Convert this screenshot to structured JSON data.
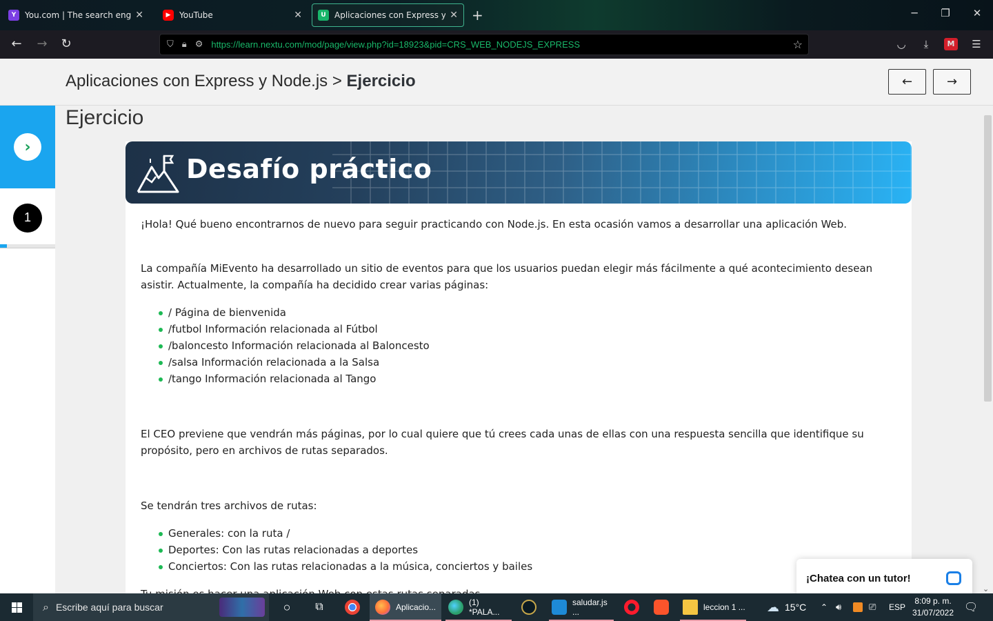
{
  "browser": {
    "tabs": [
      {
        "title": "You.com | The search engine yo",
        "favicon": "youcom-favicon",
        "color": "#7b3fe4"
      },
      {
        "title": "YouTube",
        "favicon": "youtube-favicon",
        "color": "#ff0000"
      },
      {
        "title": "Aplicaciones con Express y Nod",
        "favicon": "nextu-favicon",
        "color": "#18b56a"
      }
    ],
    "url": "https://learn.nextu.com/mod/page/view.php?id=18923&pid=CRS_WEB_NODEJS_EXPRESS"
  },
  "header": {
    "breadcrumb_course": "Aplicaciones con Express y Node.js",
    "breadcrumb_sep": " > ",
    "breadcrumb_current": "Ejercicio",
    "prev_label": "←",
    "next_label": "→"
  },
  "sidebar": {
    "toggle_icon": "chevron-right-icon",
    "step_number": "1",
    "progress_fraction": 0.12
  },
  "main": {
    "page_title": "Ejercicio",
    "banner_title": "Desafío práctico",
    "intro": "¡Hola! Qué bueno encontrarnos de nuevo para seguir practicando con Node.js. En esta ocasión vamos a desarrollar una aplicación Web.",
    "paragraph_1": "La compañía MiEvento ha desarrollado un sitio de eventos para que los usuarios puedan elegir más fácilmente a qué acontecimiento desean asistir. Actualmente, la compañía ha decidido crear varias páginas:",
    "pages_list": [
      "/ Página de bienvenida",
      "/futbol Información relacionada al Fútbol",
      "/baloncesto Información relacionada al Baloncesto",
      "/salsa Información relacionada a la Salsa",
      "/tango Información relacionada al Tango"
    ],
    "paragraph_2": "El CEO previene que vendrán más páginas, por lo cual quiere que tú crees cada unas de ellas con una respuesta sencilla que identifique su propósito, pero en archivos de rutas separados.",
    "paragraph_3": "Se tendrán tres archivos de rutas:",
    "routes_list": [
      "Generales: con la ruta /",
      "Deportes: Con las rutas relacionadas a deportes",
      "Conciertos: Con las rutas relacionadas a la música, conciertos y bailes"
    ],
    "paragraph_4": "Tu misión es hacer una aplicación Web con estas rutas separadas."
  },
  "chat": {
    "label": "¡Chatea con un tutor!"
  },
  "taskbar": {
    "search_placeholder": "Escribe aquí para buscar",
    "apps": [
      {
        "label": "",
        "icon": "chrome-icon",
        "color": "#e8453c"
      },
      {
        "label": "Aplicacio...",
        "icon": "firefox-icon",
        "color": "#ff7139"
      },
      {
        "label": "(1) *PALA...",
        "icon": "edge-icon",
        "color": "#2c9f6b"
      },
      {
        "label": "",
        "icon": "league-icon",
        "color": "#c8a84a"
      },
      {
        "label": "saludar.js ...",
        "icon": "vscode-icon",
        "color": "#1e8ad6"
      },
      {
        "label": "",
        "icon": "opera-icon",
        "color": "#ff1b2d"
      },
      {
        "label": "",
        "icon": "brave-icon",
        "color": "#fb542b"
      },
      {
        "label": "leccion 1 ...",
        "icon": "folder-icon",
        "color": "#f5c542"
      }
    ],
    "weather": "15°C",
    "language": "ESP",
    "time": "8:09 p. m.",
    "date": "31/07/2022"
  }
}
